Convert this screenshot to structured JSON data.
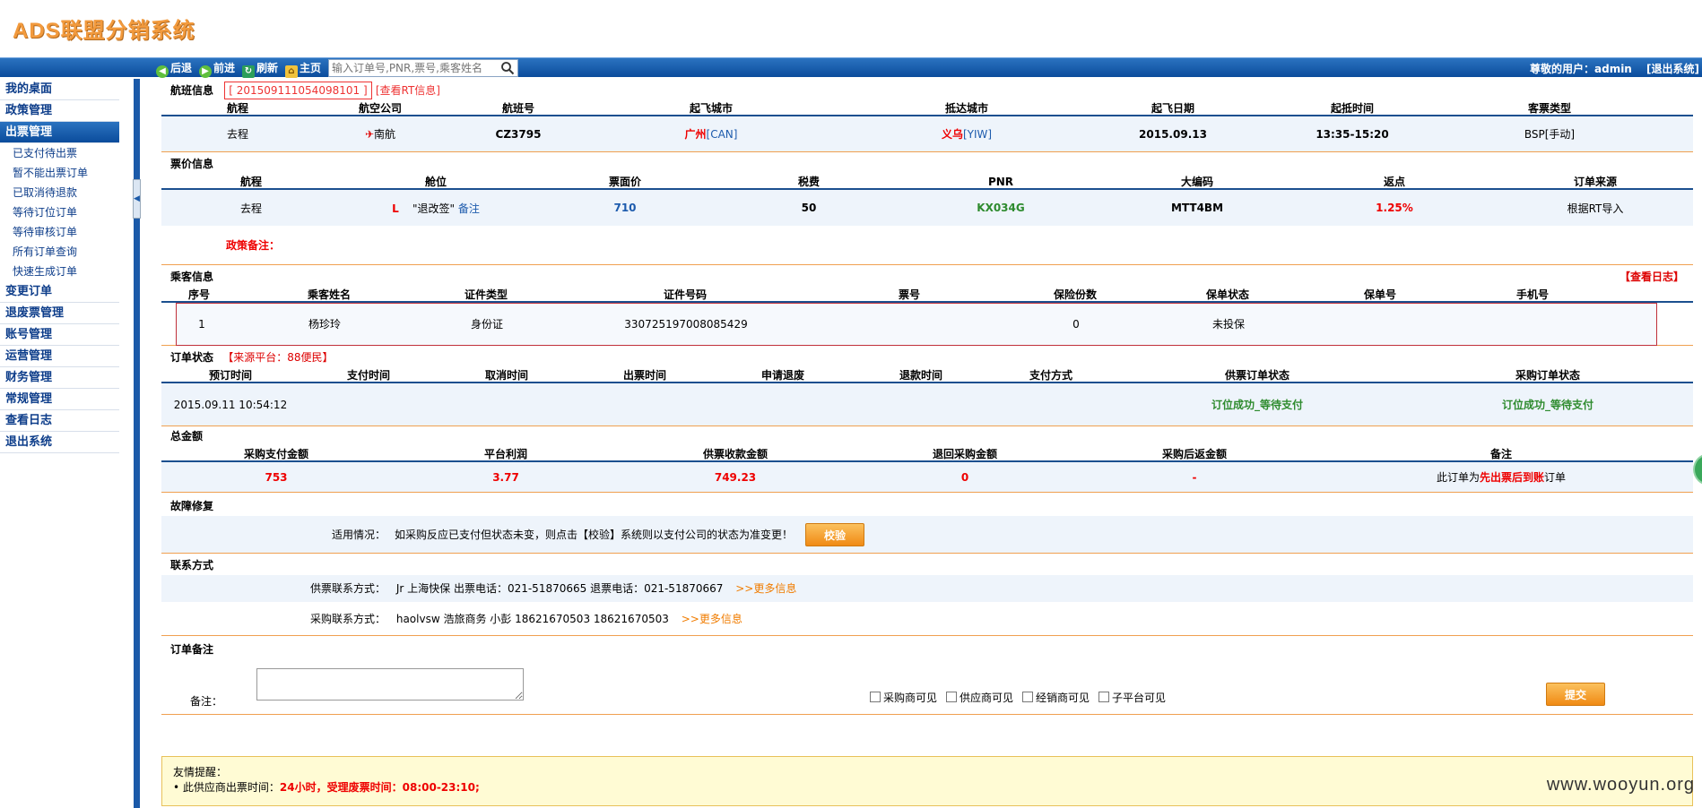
{
  "app": {
    "title": "ADS联盟分销系统"
  },
  "toolbar": {
    "back": "后退",
    "forward": "前进",
    "refresh": "刷新",
    "home": "主页",
    "search_placeholder": "输入订单号,PNR,票号,乘客姓名",
    "user_greeting": "尊敬的用户：admin",
    "logout": "[退出系统]"
  },
  "sidebar": {
    "groups": [
      {
        "label": "我的桌面"
      },
      {
        "label": "政策管理"
      },
      {
        "label": "出票管理",
        "active": true
      },
      {
        "label": "变更订单"
      },
      {
        "label": "退废票管理"
      },
      {
        "label": "账号管理"
      },
      {
        "label": "运营管理"
      },
      {
        "label": "财务管理"
      },
      {
        "label": "常规管理"
      },
      {
        "label": "查看日志"
      },
      {
        "label": "退出系统"
      }
    ],
    "sub_items": [
      "已支付待出票",
      "暂不能出票订单",
      "已取消待退款",
      "等待订位订单",
      "等待审核订单",
      "所有订单查询",
      "快速生成订单"
    ]
  },
  "flight": {
    "title": "航班信息",
    "order_no": "[ 201509111054098101 ]",
    "rt_link": "[查看RT信息]",
    "headers": [
      "航程",
      "航空公司",
      "航班号",
      "起飞城市",
      "抵达城市",
      "起飞日期",
      "起抵时间",
      "客票类型"
    ],
    "row": {
      "leg": "去程",
      "airline": "南航",
      "flight_no": "CZ3795",
      "dep_city": "广州",
      "dep_code": "[CAN]",
      "arr_city": "义乌",
      "arr_code": "[YIW]",
      "date": "2015.09.13",
      "time": "13:35-15:20",
      "ticket_type": "BSP[手动]"
    }
  },
  "fare": {
    "title": "票价信息",
    "headers": [
      "航程",
      "舱位",
      "票面价",
      "税费",
      "PNR",
      "大编码",
      "返点",
      "订单来源"
    ],
    "row": {
      "leg": "去程",
      "cabin": "L",
      "change_rule": "退改签",
      "remark": "备注",
      "price": "710",
      "tax": "50",
      "pnr": "KX034G",
      "big_pnr": "MTT4BM",
      "rebate": "1.25%",
      "source": "根据RT导入"
    },
    "policy_note_label": "政策备注："
  },
  "passenger": {
    "title": "乘客信息",
    "log_link": "【查看日志】",
    "headers": [
      "序号",
      "乘客姓名",
      "证件类型",
      "证件号码",
      "票号",
      "保险份数",
      "保单状态",
      "保单号",
      "手机号"
    ],
    "row": {
      "no": "1",
      "name": "杨珍玲",
      "id_type": "身份证",
      "id_no": "330725197008085429",
      "ticket_no": "",
      "insurance": "0",
      "policy_status": "未投保",
      "policy_no": "",
      "phone": ""
    }
  },
  "order_status": {
    "title": "订单状态",
    "source": "【来源平台：88便民】",
    "headers": [
      "预订时间",
      "支付时间",
      "取消时间",
      "出票时间",
      "申请退废",
      "退款时间",
      "支付方式",
      "供票订单状态",
      "采购订单状态"
    ],
    "row": {
      "book_time": "2015.09.11 10:54:12",
      "supply_status": "订位成功_等待支付",
      "purchase_status": "订位成功_等待支付"
    }
  },
  "amount": {
    "title": "总金额",
    "headers": [
      "采购支付金额",
      "平台利润",
      "供票收款金额",
      "退回采购金额",
      "采购后返金额",
      "备注"
    ],
    "row": {
      "purchase_pay": "753",
      "profit": "3.77",
      "supply_receive": "749.23",
      "refund": "0",
      "back_rebate": "-",
      "note_prefix": "此订单为",
      "note_highlight": "先出票后到账",
      "note_suffix": "订单"
    }
  },
  "repair": {
    "title": "故障修复",
    "label": "适用情况：",
    "text": "如采购反应已支付但状态未变，则点击【校验】系统则以支付公司的状态为准变更！",
    "button": "校验"
  },
  "contact": {
    "title": "联系方式",
    "supply_label": "供票联系方式：",
    "supply_text": "Jr 上海快保 出票电话：021-51870665 退票电话：021-51870667",
    "purchase_label": "采购联系方式：",
    "purchase_text": "haolvsw 浩旅商务 小彭 18621670503 18621670503",
    "more": ">>更多信息"
  },
  "order_note": {
    "title": "订单备注",
    "label": "备注：",
    "checkboxes": [
      "采购商可见",
      "供应商可见",
      "经销商可见",
      "子平台可见"
    ],
    "submit": "提交"
  },
  "tip": {
    "title": "友情提醒：",
    "prefix": "此供应商出票时间：",
    "highlight": "24小时，受理废票时间：08:00-23:10;"
  },
  "watermark": "www.wooyun.org"
}
